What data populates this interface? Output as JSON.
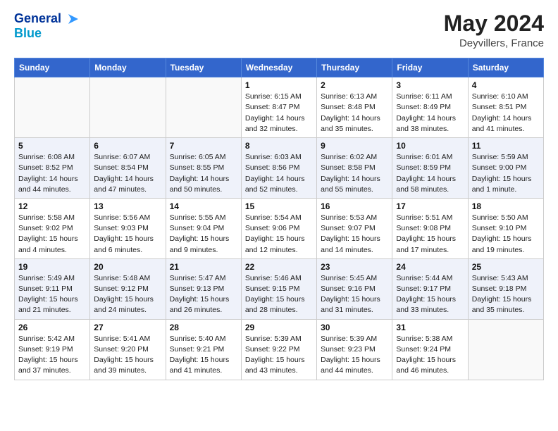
{
  "header": {
    "logo_line1": "General",
    "logo_line2": "Blue",
    "month": "May 2024",
    "location": "Deyvillers, France"
  },
  "days_of_week": [
    "Sunday",
    "Monday",
    "Tuesday",
    "Wednesday",
    "Thursday",
    "Friday",
    "Saturday"
  ],
  "weeks": [
    [
      {
        "day": "",
        "info": ""
      },
      {
        "day": "",
        "info": ""
      },
      {
        "day": "",
        "info": ""
      },
      {
        "day": "1",
        "info": "Sunrise: 6:15 AM\nSunset: 8:47 PM\nDaylight: 14 hours and 32 minutes."
      },
      {
        "day": "2",
        "info": "Sunrise: 6:13 AM\nSunset: 8:48 PM\nDaylight: 14 hours and 35 minutes."
      },
      {
        "day": "3",
        "info": "Sunrise: 6:11 AM\nSunset: 8:49 PM\nDaylight: 14 hours and 38 minutes."
      },
      {
        "day": "4",
        "info": "Sunrise: 6:10 AM\nSunset: 8:51 PM\nDaylight: 14 hours and 41 minutes."
      }
    ],
    [
      {
        "day": "5",
        "info": "Sunrise: 6:08 AM\nSunset: 8:52 PM\nDaylight: 14 hours and 44 minutes."
      },
      {
        "day": "6",
        "info": "Sunrise: 6:07 AM\nSunset: 8:54 PM\nDaylight: 14 hours and 47 minutes."
      },
      {
        "day": "7",
        "info": "Sunrise: 6:05 AM\nSunset: 8:55 PM\nDaylight: 14 hours and 50 minutes."
      },
      {
        "day": "8",
        "info": "Sunrise: 6:03 AM\nSunset: 8:56 PM\nDaylight: 14 hours and 52 minutes."
      },
      {
        "day": "9",
        "info": "Sunrise: 6:02 AM\nSunset: 8:58 PM\nDaylight: 14 hours and 55 minutes."
      },
      {
        "day": "10",
        "info": "Sunrise: 6:01 AM\nSunset: 8:59 PM\nDaylight: 14 hours and 58 minutes."
      },
      {
        "day": "11",
        "info": "Sunrise: 5:59 AM\nSunset: 9:00 PM\nDaylight: 15 hours and 1 minute."
      }
    ],
    [
      {
        "day": "12",
        "info": "Sunrise: 5:58 AM\nSunset: 9:02 PM\nDaylight: 15 hours and 4 minutes."
      },
      {
        "day": "13",
        "info": "Sunrise: 5:56 AM\nSunset: 9:03 PM\nDaylight: 15 hours and 6 minutes."
      },
      {
        "day": "14",
        "info": "Sunrise: 5:55 AM\nSunset: 9:04 PM\nDaylight: 15 hours and 9 minutes."
      },
      {
        "day": "15",
        "info": "Sunrise: 5:54 AM\nSunset: 9:06 PM\nDaylight: 15 hours and 12 minutes."
      },
      {
        "day": "16",
        "info": "Sunrise: 5:53 AM\nSunset: 9:07 PM\nDaylight: 15 hours and 14 minutes."
      },
      {
        "day": "17",
        "info": "Sunrise: 5:51 AM\nSunset: 9:08 PM\nDaylight: 15 hours and 17 minutes."
      },
      {
        "day": "18",
        "info": "Sunrise: 5:50 AM\nSunset: 9:10 PM\nDaylight: 15 hours and 19 minutes."
      }
    ],
    [
      {
        "day": "19",
        "info": "Sunrise: 5:49 AM\nSunset: 9:11 PM\nDaylight: 15 hours and 21 minutes."
      },
      {
        "day": "20",
        "info": "Sunrise: 5:48 AM\nSunset: 9:12 PM\nDaylight: 15 hours and 24 minutes."
      },
      {
        "day": "21",
        "info": "Sunrise: 5:47 AM\nSunset: 9:13 PM\nDaylight: 15 hours and 26 minutes."
      },
      {
        "day": "22",
        "info": "Sunrise: 5:46 AM\nSunset: 9:15 PM\nDaylight: 15 hours and 28 minutes."
      },
      {
        "day": "23",
        "info": "Sunrise: 5:45 AM\nSunset: 9:16 PM\nDaylight: 15 hours and 31 minutes."
      },
      {
        "day": "24",
        "info": "Sunrise: 5:44 AM\nSunset: 9:17 PM\nDaylight: 15 hours and 33 minutes."
      },
      {
        "day": "25",
        "info": "Sunrise: 5:43 AM\nSunset: 9:18 PM\nDaylight: 15 hours and 35 minutes."
      }
    ],
    [
      {
        "day": "26",
        "info": "Sunrise: 5:42 AM\nSunset: 9:19 PM\nDaylight: 15 hours and 37 minutes."
      },
      {
        "day": "27",
        "info": "Sunrise: 5:41 AM\nSunset: 9:20 PM\nDaylight: 15 hours and 39 minutes."
      },
      {
        "day": "28",
        "info": "Sunrise: 5:40 AM\nSunset: 9:21 PM\nDaylight: 15 hours and 41 minutes."
      },
      {
        "day": "29",
        "info": "Sunrise: 5:39 AM\nSunset: 9:22 PM\nDaylight: 15 hours and 43 minutes."
      },
      {
        "day": "30",
        "info": "Sunrise: 5:39 AM\nSunset: 9:23 PM\nDaylight: 15 hours and 44 minutes."
      },
      {
        "day": "31",
        "info": "Sunrise: 5:38 AM\nSunset: 9:24 PM\nDaylight: 15 hours and 46 minutes."
      },
      {
        "day": "",
        "info": ""
      }
    ]
  ]
}
